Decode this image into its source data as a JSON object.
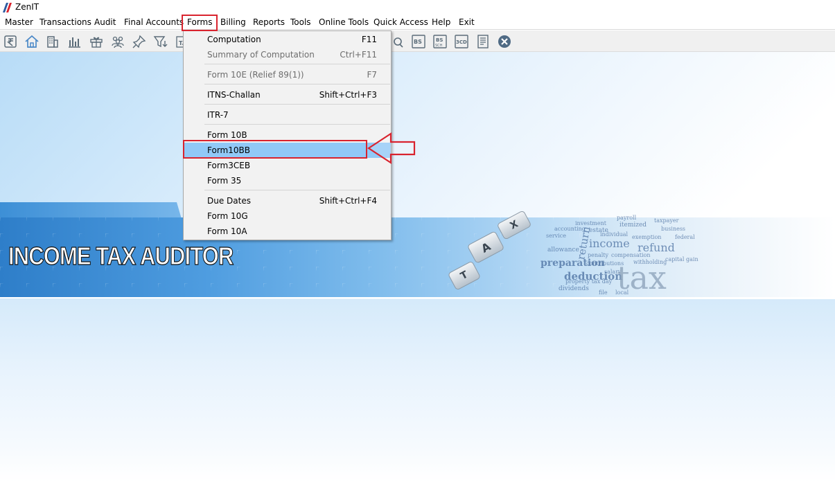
{
  "window": {
    "title": "ZenIT"
  },
  "menubar": {
    "items": [
      "Master",
      "Transactions",
      "Audit",
      "Final Accounts",
      "Forms",
      "Billing",
      "Reports",
      "Tools",
      "Online Tools",
      "Quick Access",
      "Help",
      "Exit"
    ],
    "active": "Forms"
  },
  "toolbar": {
    "icons": [
      "rupee-book-icon",
      "home-icon",
      "building-icon",
      "bar-chart-icon",
      "gift-icon",
      "people-icon",
      "pin-icon",
      "filter-download-icon",
      "tax-icon",
      "bs-icon",
      "bs-sch-icon",
      "3cd-icon",
      "report-list-icon",
      "close-circle-icon"
    ],
    "labels": {
      "tax": "TA",
      "bs": "BS",
      "bs_sch_top": "BS",
      "bs_sch_bottom": "SCH",
      "three_cd": "3CD"
    }
  },
  "forms_menu": {
    "items": [
      {
        "label": "Computation",
        "shortcut": "F11",
        "disabled": false
      },
      {
        "label": "Summary of Computation",
        "shortcut": "Ctrl+F11",
        "disabled": true
      },
      {
        "label": "Form 10E (Relief 89(1))",
        "shortcut": "F7",
        "disabled": true
      },
      {
        "label": "ITNS-Challan",
        "shortcut": "Shift+Ctrl+F3",
        "disabled": false
      },
      {
        "label": "ITR-7",
        "shortcut": "",
        "disabled": false
      },
      {
        "label": "Form 10B",
        "shortcut": "",
        "disabled": false
      },
      {
        "label": "Form10BB",
        "shortcut": "",
        "disabled": false,
        "selected": true
      },
      {
        "label": "Form3CEB",
        "shortcut": "",
        "disabled": false
      },
      {
        "label": "Form 35",
        "shortcut": "",
        "disabled": false
      },
      {
        "label": "Due Dates",
        "shortcut": "Shift+Ctrl+F4",
        "disabled": false
      },
      {
        "label": "Form 10G",
        "shortcut": "",
        "disabled": false
      },
      {
        "label": "Form 10A",
        "shortcut": "",
        "disabled": false
      }
    ]
  },
  "banner": {
    "title": "INCOME TAX AUDITOR",
    "keys": [
      "A",
      "T",
      "X"
    ],
    "word_cloud": [
      "payroll",
      "itemized",
      "investment",
      "estate",
      "return",
      "income",
      "refund",
      "preparation",
      "penalty",
      "compensation",
      "deduction",
      "salary",
      "tax",
      "dividends",
      "property tax day",
      "local",
      "file",
      "federal",
      "accounting",
      "individual",
      "exemption",
      "withholding",
      "contributions",
      "capital gain",
      "allowance",
      "taxpayer",
      "business",
      "service"
    ]
  },
  "colors": {
    "highlight_red": "#d9232e",
    "selection_blue": "#91c9f7",
    "menu_bg": "#f2f2f2"
  }
}
